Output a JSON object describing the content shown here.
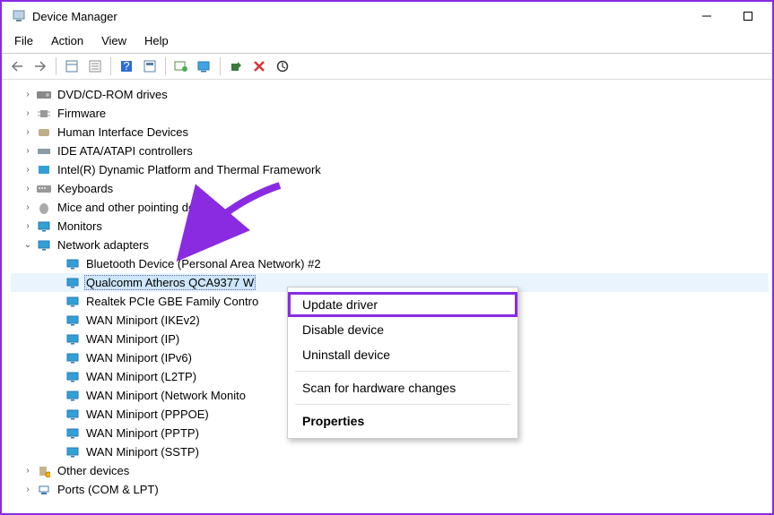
{
  "title": "Device Manager",
  "menus": {
    "file": "File",
    "action": "Action",
    "view": "View",
    "help": "Help"
  },
  "tree": {
    "n0": "DVD/CD-ROM drives",
    "n1": "Firmware",
    "n2": "Human Interface Devices",
    "n3": "IDE ATA/ATAPI controllers",
    "n4": "Intel(R) Dynamic Platform and Thermal Framework",
    "n5": "Keyboards",
    "n6": "Mice and other pointing devices",
    "n7": "Monitors",
    "n8": "Network adapters",
    "n8c": {
      "c0": "Bluetooth Device (Personal Area Network) #2",
      "c1": "Qualcomm Atheros QCA9377 W",
      "c2": "Realtek PCIe GBE Family Contro",
      "c3": "WAN Miniport (IKEv2)",
      "c4": "WAN Miniport (IP)",
      "c5": "WAN Miniport (IPv6)",
      "c6": "WAN Miniport (L2TP)",
      "c7": "WAN Miniport (Network Monito",
      "c8": "WAN Miniport (PPPOE)",
      "c9": "WAN Miniport (PPTP)",
      "c10": "WAN Miniport (SSTP)"
    },
    "n9": "Other devices",
    "n10": "Ports (COM & LPT)"
  },
  "context": {
    "update": "Update driver",
    "disable": "Disable device",
    "uninstall": "Uninstall device",
    "scan": "Scan for hardware changes",
    "properties": "Properties"
  },
  "glyphs": {
    "chev_right": "›",
    "chev_down": "⌄"
  }
}
